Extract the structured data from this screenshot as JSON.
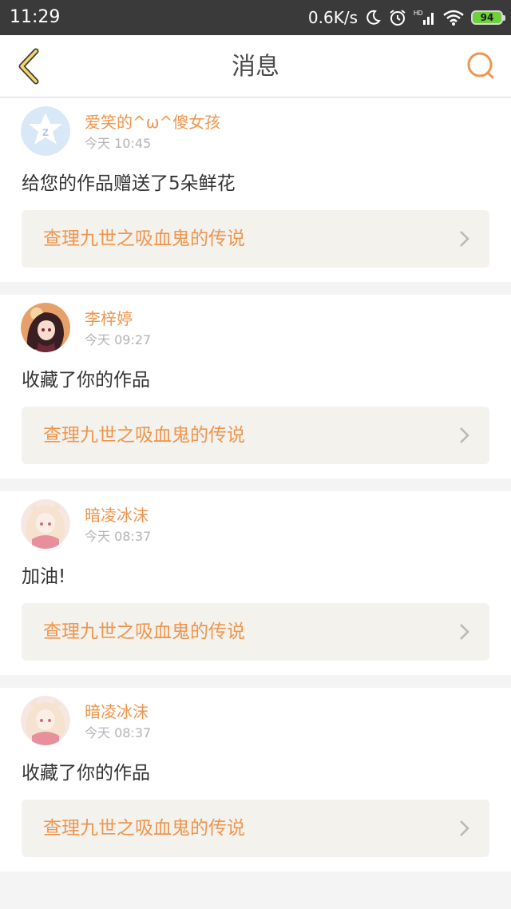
{
  "status_bar": {
    "time": "11:29",
    "net_speed": "0.6K/s",
    "battery_level": "94",
    "icons": [
      "moon-icon",
      "alarm-icon",
      "hd-signal-icon",
      "wifi-icon",
      "battery-icon"
    ]
  },
  "header": {
    "title": "消息",
    "back_icon": "chevron-left-icon",
    "search_icon": "search-icon",
    "accent_color": "#f0954e"
  },
  "messages": [
    {
      "user": "爱笑的^ω^傻女孩",
      "time": "今天 10:45",
      "text": "给您的作品赠送了5朵鲜花",
      "work": "查理九世之吸血鬼的传说",
      "avatar": "default-avatar-icon"
    },
    {
      "user": "李梓婷",
      "time": "今天 09:27",
      "text": "收藏了你的作品",
      "work": "查理九世之吸血鬼的传说",
      "avatar": "anime-avatar-dark"
    },
    {
      "user": "暗凌冰沫",
      "time": "今天 08:37",
      "text": "加油!",
      "work": "查理九世之吸血鬼的传说",
      "avatar": "anime-avatar-pink"
    },
    {
      "user": "暗凌冰沫",
      "time": "今天 08:37",
      "text": "收藏了你的作品",
      "work": "查理九世之吸血鬼的传说",
      "avatar": "anime-avatar-pink"
    }
  ]
}
